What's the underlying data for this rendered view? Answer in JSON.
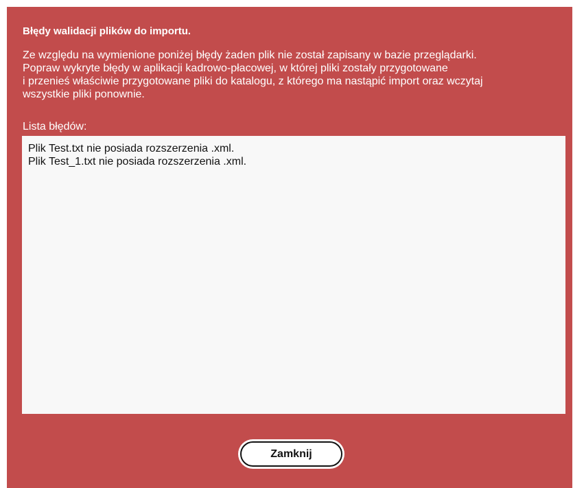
{
  "dialog": {
    "title": "Błędy walidacji plików do importu.",
    "message_lines": [
      "Ze względu na wymienione poniżej błędy żaden plik nie został zapisany w bazie przeglądarki.",
      "Popraw wykryte błędy w aplikacji kadrowo-płacowej, w której pliki zostały przygotowane",
      "i przenieś właściwie przygotowane pliki do katalogu, z którego ma nastąpić import oraz wczytaj",
      "wszystkie pliki ponownie."
    ],
    "list_label": "Lista błędów:",
    "errors": [
      "Plik Test.txt nie posiada rozszerzenia .xml.",
      "Plik Test_1.txt nie posiada rozszerzenia .xml."
    ],
    "close_label": "Zamknij"
  },
  "colors": {
    "dialog_background": "#c24c4c",
    "text_light": "#ffffff",
    "list_background": "#f8f8f8",
    "button_background": "#ffffff"
  }
}
